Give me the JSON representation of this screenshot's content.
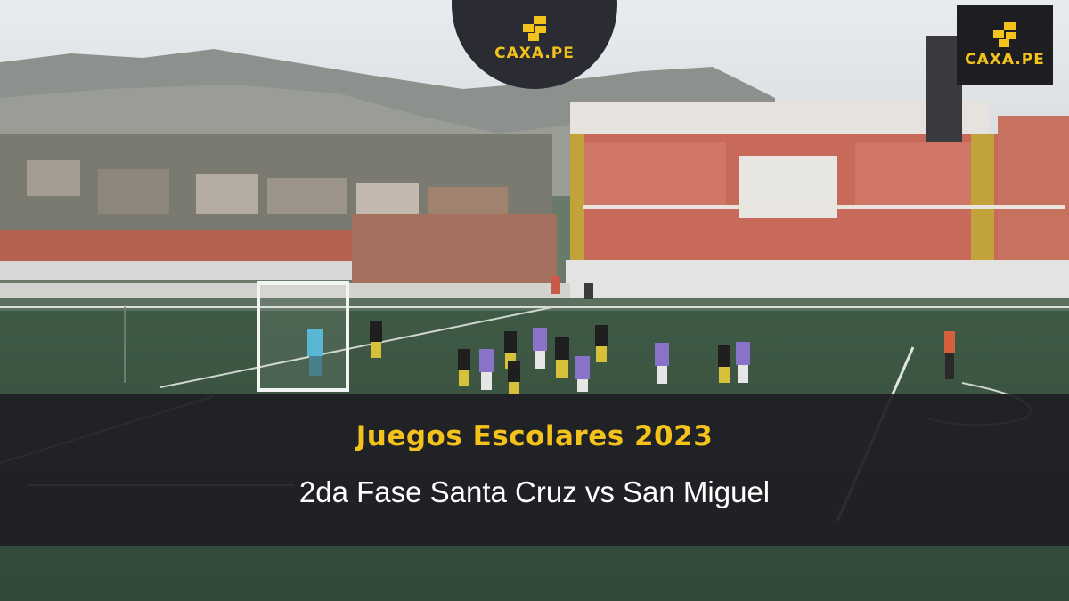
{
  "brand": {
    "logo_text": "CAXA.PE",
    "accent_color": "#f3c21b",
    "logo_bg": "#2b2b33"
  },
  "caption": {
    "title": "Juegos Escolares 2023",
    "subtitle": "2da Fase Santa Cruz vs San Miguel"
  },
  "scene": {
    "description_icon": "football-match-photo"
  }
}
